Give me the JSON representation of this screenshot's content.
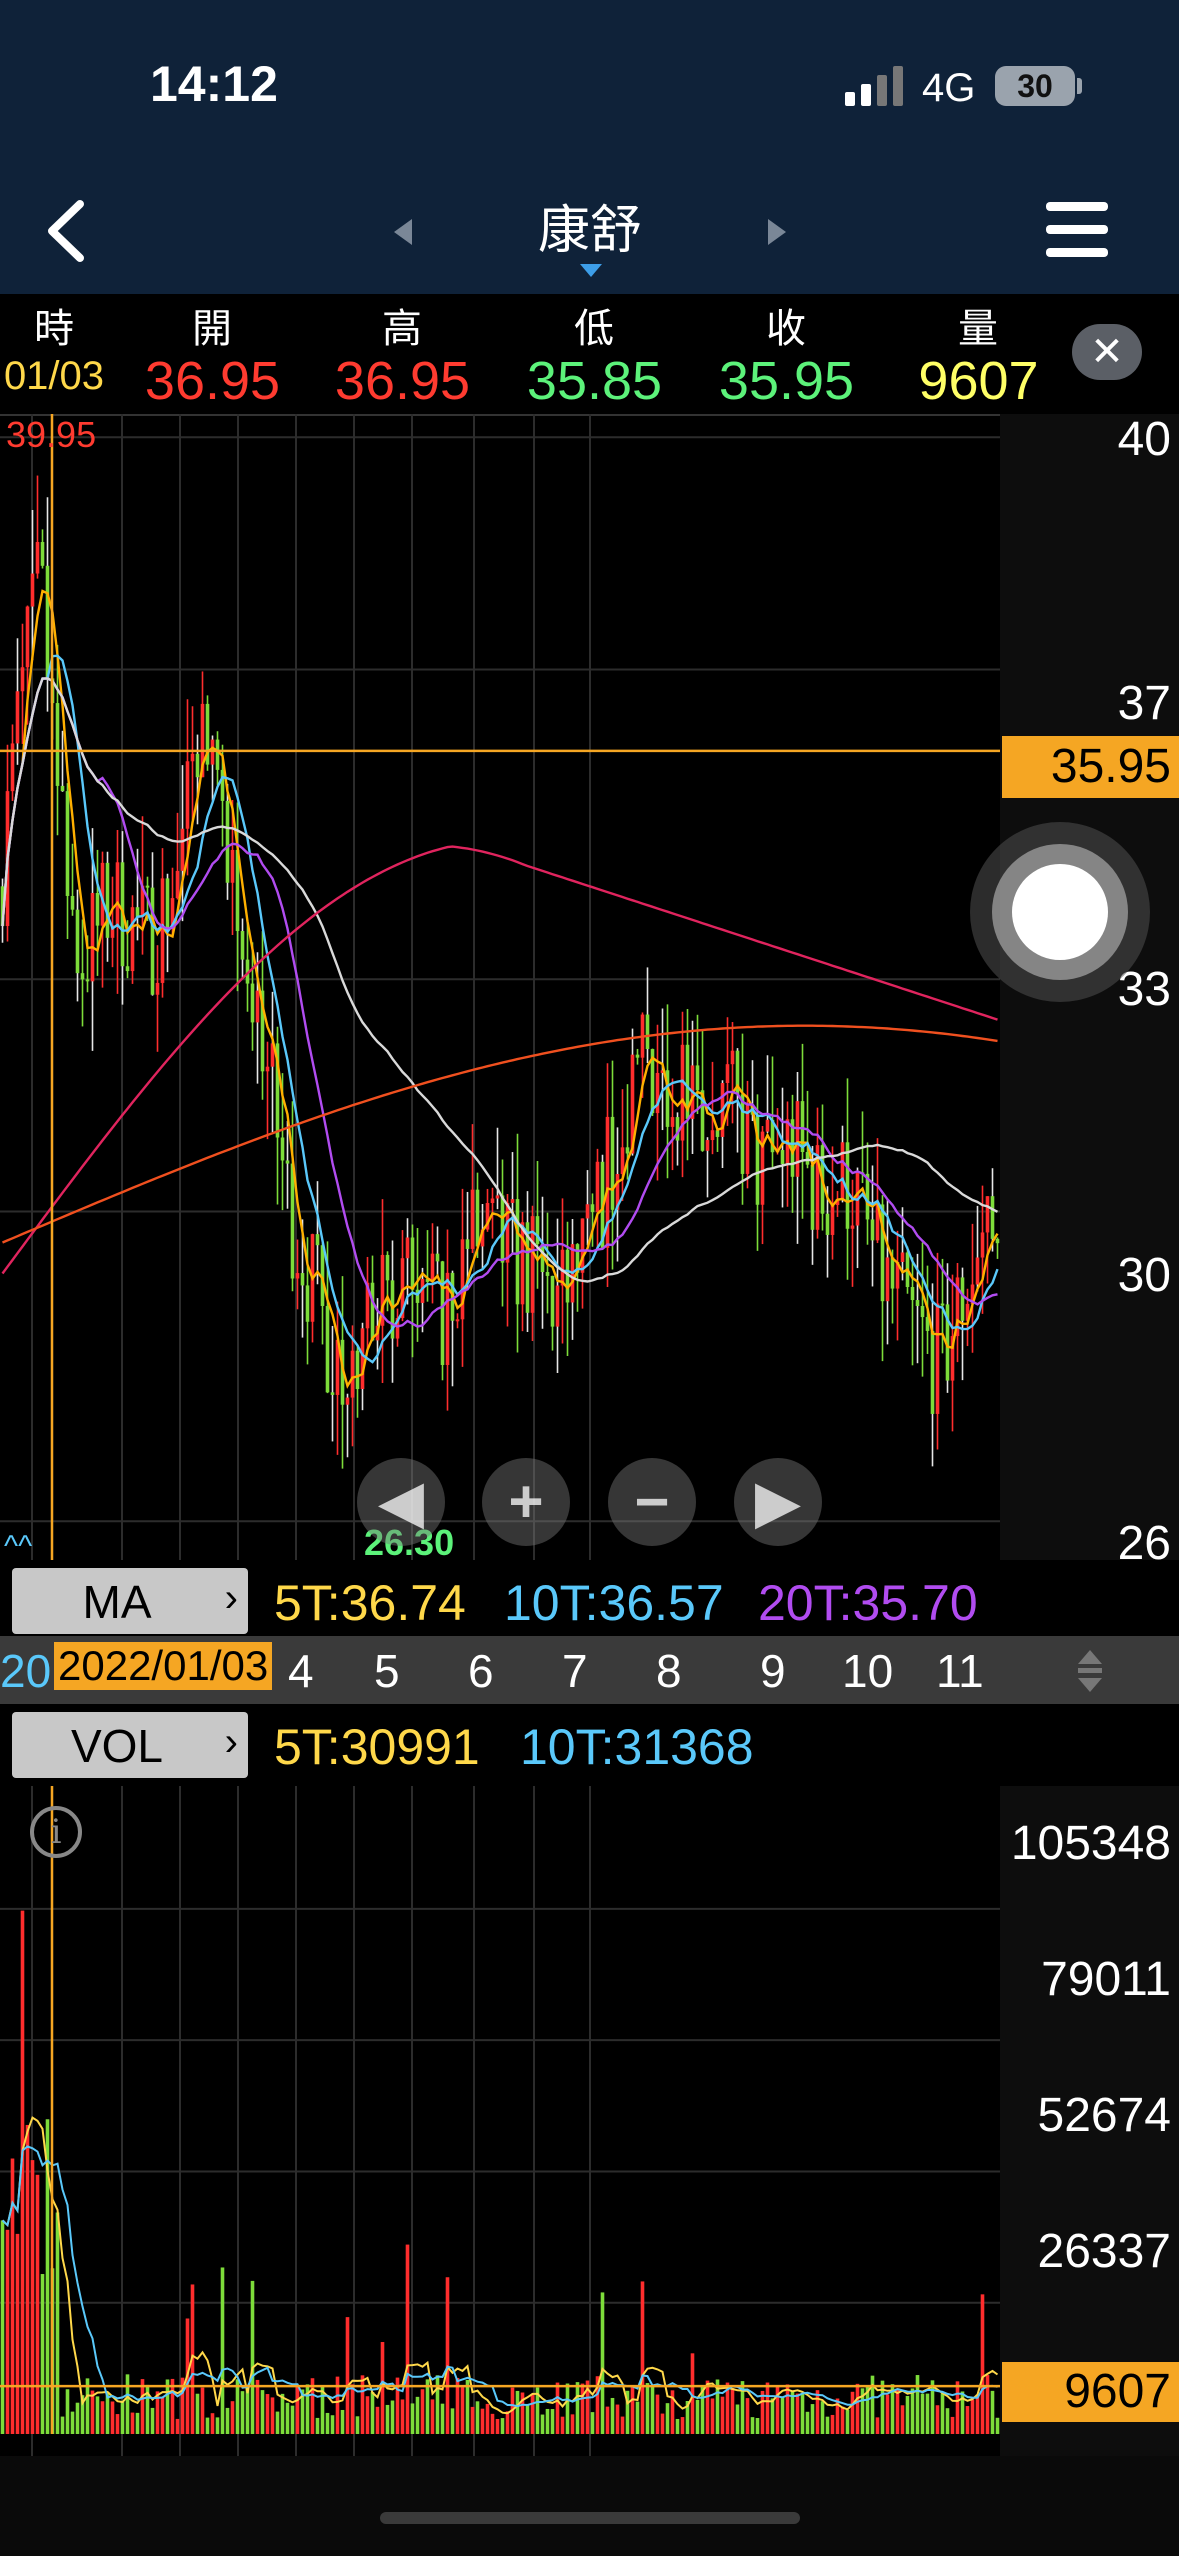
{
  "status_bar": {
    "time": "14:12",
    "network": "4G",
    "battery": "30"
  },
  "nav": {
    "title": "康舒"
  },
  "quote": {
    "headers": [
      "時",
      "開",
      "高",
      "低",
      "收",
      "量"
    ],
    "values": [
      "01/03",
      "36.95",
      "36.95",
      "35.85",
      "35.95",
      "9607"
    ],
    "colors": [
      "#ffd84a",
      "#ff3b30",
      "#ff3b30",
      "#5cf27a",
      "#5cf27a",
      "#ffff66"
    ]
  },
  "price_chart": {
    "y_labels": [
      "40",
      "37",
      "33",
      "30",
      "26"
    ],
    "high_marker": "39.95",
    "low_marker": "26.30",
    "crosshair_price": "35.95",
    "scroll_marker": "^^"
  },
  "ma_bar": {
    "button": "MA",
    "items": [
      {
        "text": "5T:36.74",
        "color": "#ffd84a"
      },
      {
        "text": "10T:36.57",
        "color": "#5ac8fa"
      },
      {
        "text": "20T:35.70",
        "color": "#b14cf0"
      }
    ]
  },
  "date_axis": {
    "labels": [
      "20",
      "4",
      "5",
      "6",
      "7",
      "8",
      "9",
      "10",
      "11"
    ],
    "cross_date": "2022/01/03"
  },
  "vol_bar": {
    "button": "VOL",
    "items": [
      {
        "text": "5T:30991",
        "color": "#ffd84a"
      },
      {
        "text": "10T:31368",
        "color": "#5ac8fa"
      }
    ]
  },
  "volume_chart": {
    "y_labels": [
      "105348",
      "79011",
      "52674",
      "26337"
    ],
    "crosshair_volume": "9607"
  },
  "icons": {
    "back": "chevron-left-icon",
    "prev": "triangle-left-icon",
    "next": "triangle-right-icon",
    "menu": "hamburger-menu-icon",
    "close": "close-icon",
    "info": "info-icon",
    "zoom_in": "plus-icon",
    "zoom_out": "minus-icon",
    "scroll_left": "triangle-left-icon",
    "scroll_right": "triangle-right-icon"
  },
  "chart_data": {
    "type": "candlestick",
    "price_axis_ticks": [
      40,
      37,
      33,
      30,
      26
    ],
    "price_range": [
      25.5,
      40.3
    ],
    "ma_lines": [
      "MA5",
      "MA10",
      "MA20",
      "MA60",
      "MA120",
      "MA240"
    ],
    "ma_colors": [
      "#ffb000",
      "#5ac8fa",
      "#b14cf0",
      "#d9d9d9",
      "#e0245e",
      "#f0501f"
    ],
    "grid": true,
    "volume_axis_ticks": [
      105348,
      79011,
      52674,
      26337
    ],
    "volume_range": [
      0,
      130000
    ],
    "selected": {
      "date": "2022/01/03",
      "close": 35.95,
      "volume": 9607
    }
  }
}
